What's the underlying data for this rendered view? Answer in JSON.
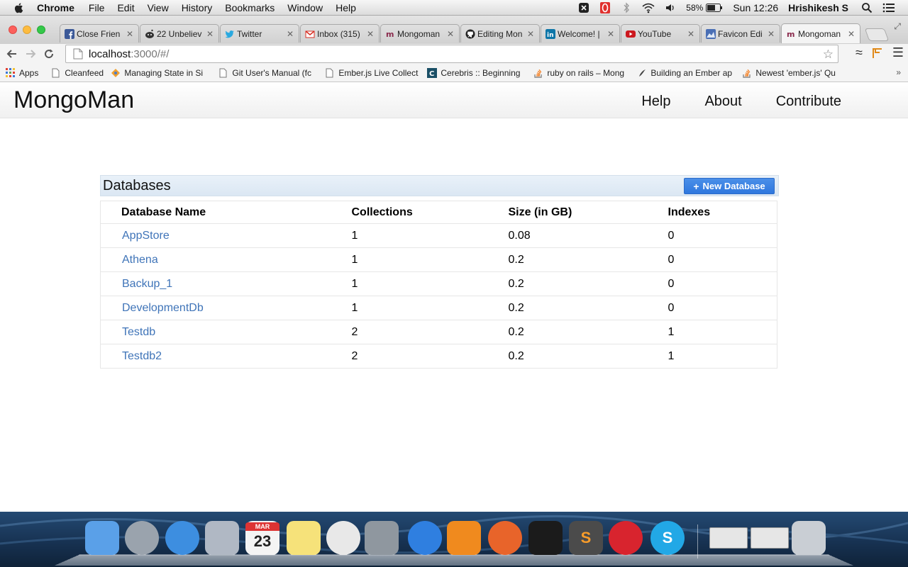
{
  "menubar": {
    "app_name": "Chrome",
    "menus": [
      "File",
      "Edit",
      "View",
      "History",
      "Bookmarks",
      "Window",
      "Help"
    ],
    "battery": "58%",
    "clock": "Sun 12:26",
    "user": "Hrishikesh S"
  },
  "tabs": [
    {
      "label": "Close Frien",
      "icon": "facebook-icon",
      "color": "#3b5998"
    },
    {
      "label": "22 Unbeliev",
      "icon": "reddit-icon",
      "color": "#333333"
    },
    {
      "label": "Twitter",
      "icon": "twitter-icon",
      "color": "#2aa9e0"
    },
    {
      "label": "Inbox (315)",
      "icon": "gmail-icon",
      "color": "#d93025"
    },
    {
      "label": "Mongoman",
      "icon": "mongoman-icon",
      "color": "#8a2b4d"
    },
    {
      "label": "Editing Mon",
      "icon": "github-icon",
      "color": "#222222"
    },
    {
      "label": "Welcome! |",
      "icon": "linkedin-icon",
      "color": "#0e76a8"
    },
    {
      "label": "YouTube",
      "icon": "youtube-icon",
      "color": "#cc181e"
    },
    {
      "label": "Favicon Edi",
      "icon": "favicon-editor-icon",
      "color": "#4a6fb5"
    },
    {
      "label": "Mongoman",
      "icon": "mongoman-icon",
      "color": "#8a2b4d",
      "active": true
    }
  ],
  "toolbar": {
    "url_host": "localhost",
    "url_path": ":3000/#/"
  },
  "bookmarks": [
    {
      "label": "Apps",
      "icon": "apps-grid-icon"
    },
    {
      "label": "Cleanfeed",
      "icon": "page-icon"
    },
    {
      "label": "Managing State in Si",
      "icon": "bookmark-favicon-icon"
    },
    {
      "label": "Git User's Manual (fc",
      "icon": "page-icon"
    },
    {
      "label": "Ember.js Live Collect",
      "icon": "page-icon"
    },
    {
      "label": "Cerebris :: Beginning",
      "icon": "cerebris-icon"
    },
    {
      "label": "ruby on rails – Mong",
      "icon": "stackoverflow-icon"
    },
    {
      "label": "Building an Ember ap",
      "icon": "ember-icon"
    },
    {
      "label": "Newest 'ember.js' Qu",
      "icon": "stackoverflow-icon"
    }
  ],
  "app": {
    "brand": "MongoMan",
    "nav": [
      "Help",
      "About",
      "Contribute"
    ]
  },
  "panel": {
    "title": "Databases",
    "new_button": "New Database",
    "plus": "+",
    "columns": [
      "Database Name",
      "Collections",
      "Size (in GB)",
      "Indexes"
    ],
    "rows": [
      [
        "AppStore",
        "1",
        "0.08",
        "0"
      ],
      [
        "Athena",
        "1",
        "0.2",
        "0"
      ],
      [
        "Backup_1",
        "1",
        "0.2",
        "0"
      ],
      [
        "DevelopmentDb",
        "1",
        "0.2",
        "0"
      ],
      [
        "Testdb",
        "2",
        "0.2",
        "1"
      ],
      [
        "Testdb2",
        "2",
        "0.2",
        "1"
      ]
    ]
  },
  "dock": [
    {
      "name": "finder",
      "color": "#5aa0e8"
    },
    {
      "name": "launchpad",
      "color": "#9aa3ad"
    },
    {
      "name": "safari",
      "color": "#3d8ee0"
    },
    {
      "name": "mail",
      "color": "#b0b8c4"
    },
    {
      "name": "calendar",
      "color": "#f4f4f4",
      "text": "23",
      "month": "MAR"
    },
    {
      "name": "stickies",
      "color": "#f6e27a"
    },
    {
      "name": "chrome",
      "color": "#e8e8e8"
    },
    {
      "name": "facetime",
      "color": "#8f979f"
    },
    {
      "name": "itunes",
      "color": "#2f7fe0"
    },
    {
      "name": "ibooks",
      "color": "#f08a1e"
    },
    {
      "name": "firefox",
      "color": "#e8642a"
    },
    {
      "name": "terminal",
      "color": "#1b1b1b"
    },
    {
      "name": "sublime-text",
      "color": "#4b4b4b",
      "text": "S"
    },
    {
      "name": "opera",
      "color": "#d8242e"
    },
    {
      "name": "skype",
      "color": "#22a8e6",
      "text": "S"
    },
    {
      "name": "window-preview-1",
      "color": "#e6e6e6"
    },
    {
      "name": "window-preview-2",
      "color": "#e6e6e6"
    },
    {
      "name": "trash",
      "color": "#c9ced4"
    }
  ]
}
